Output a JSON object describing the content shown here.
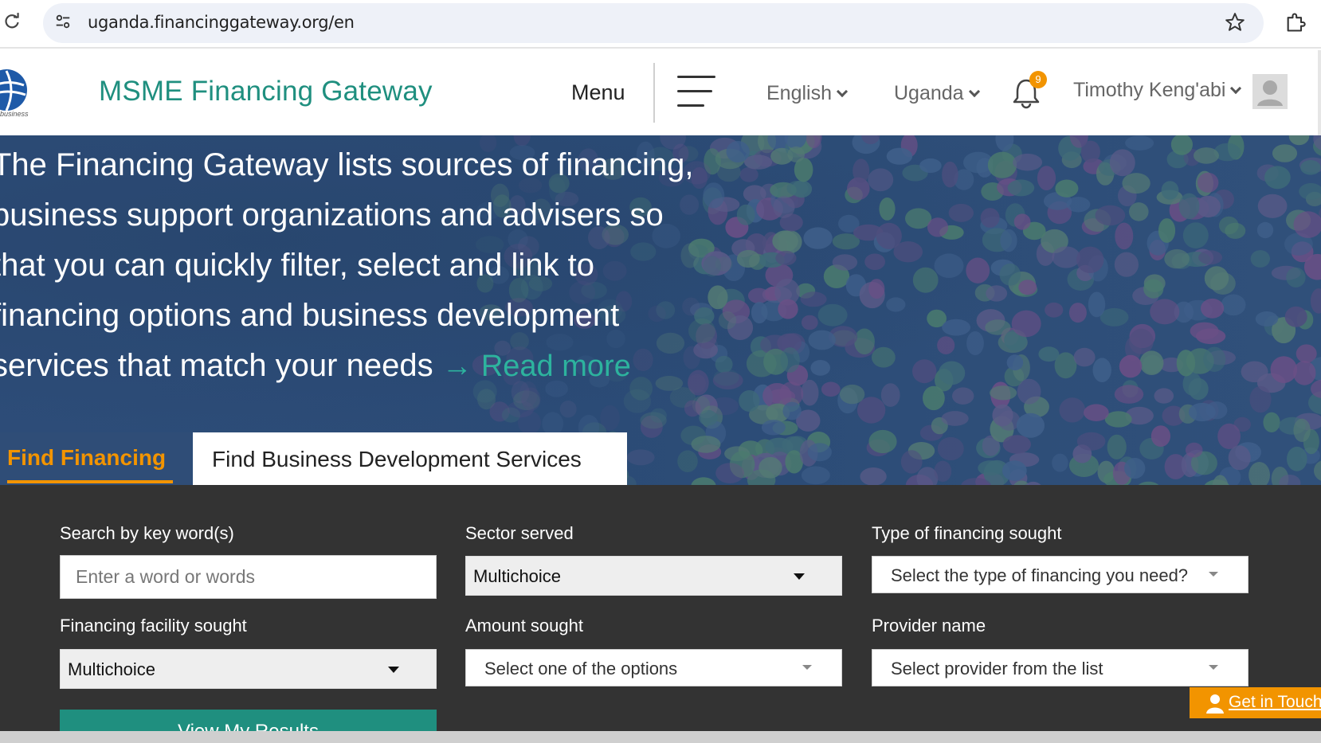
{
  "browser": {
    "url": "uganda.financinggateway.org/en",
    "icons": [
      "reload-icon",
      "site-info-icon",
      "bookmark-star-icon",
      "extensions-icon"
    ]
  },
  "header": {
    "title": "MSME Financing Gateway",
    "menu_label": "Menu",
    "language": "English",
    "country": "Uganda",
    "notification_count": "9",
    "user_name": "Timothy Keng'abi",
    "logo_caption": "business"
  },
  "hero": {
    "lines": [
      "The Financing Gateway lists sources of financing,",
      "business support organizations and advisers so",
      "that you can quickly filter, select and link to",
      "financing options and business development",
      "services that match your needs"
    ],
    "read_more": "Read more"
  },
  "tabs": {
    "active": "Find Financing",
    "inactive": "Find Business Development Services"
  },
  "search": {
    "keyword_label": "Search by key word(s)",
    "keyword_placeholder": "Enter a word or words",
    "sector_label": "Sector served",
    "sector_value": "Multichoice",
    "financing_type_label": "Type of financing sought",
    "financing_type_value": "Select the type of financing you need?",
    "facility_label": "Financing facility sought",
    "facility_value": "Multichoice",
    "amount_label": "Amount sought",
    "amount_value": "Select one of the options",
    "provider_label": "Provider name",
    "provider_value": "Select provider from the list",
    "results_button": "View My Results"
  },
  "floating": {
    "get_in_touch": "Get in Touch"
  },
  "colors": {
    "brand_teal": "#1f8f7f",
    "accent_orange": "#f29400",
    "panel_dark": "#333333",
    "hero_blue": "#2d4c78"
  }
}
